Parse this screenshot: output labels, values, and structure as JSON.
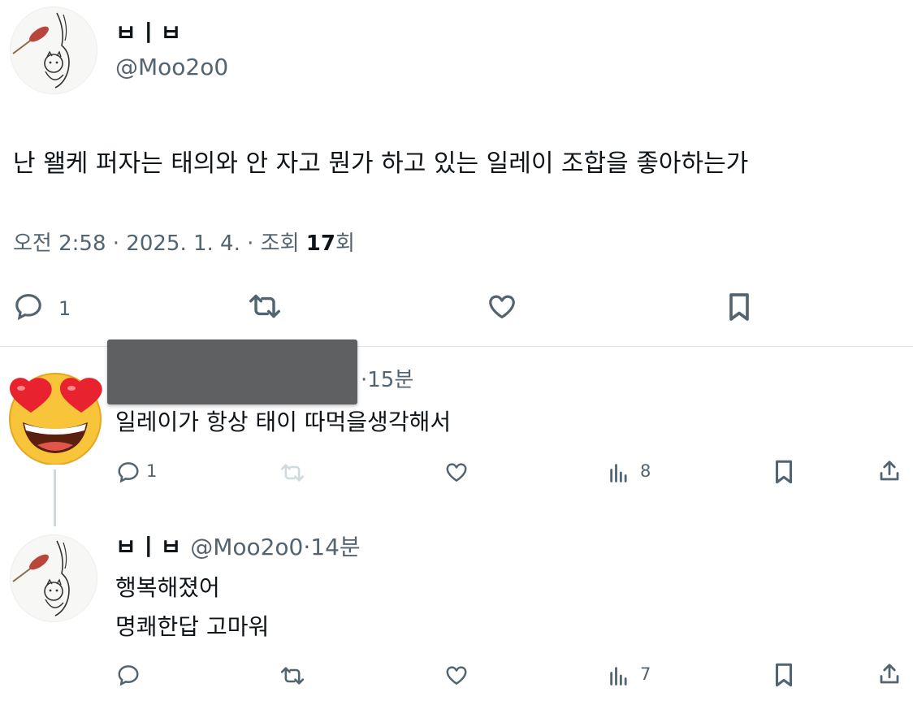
{
  "main_tweet": {
    "display_name": "ㅂㅣㅂ",
    "handle": "@Moo2o0",
    "text": "난 왤케 퍼자는 태의와 안 자고 뭔가 하고 있는 일레이 조합을 좋아하는가",
    "timestamp": "오전 2:58 · 2025. 1. 4. · 조회 ",
    "views": "17",
    "views_suffix": "회",
    "reply_count": "1",
    "colors": {
      "text": "#0f1419",
      "secondary": "#536471",
      "divider": "#e3e6e9"
    }
  },
  "reply1": {
    "time": "·15분",
    "text": "일레이가 항상 태이 따먹을생각해서",
    "reply_count": "1",
    "view_count": "8",
    "avatar_icon": "heart-eyes-emoji-icon"
  },
  "reply2": {
    "display_name": "ㅂㅣㅂ",
    "handle": "@Moo2o0",
    "time": "·14분",
    "line1": "행복해졌어",
    "line2": "명쾌한답 고마워",
    "view_count": "7"
  }
}
